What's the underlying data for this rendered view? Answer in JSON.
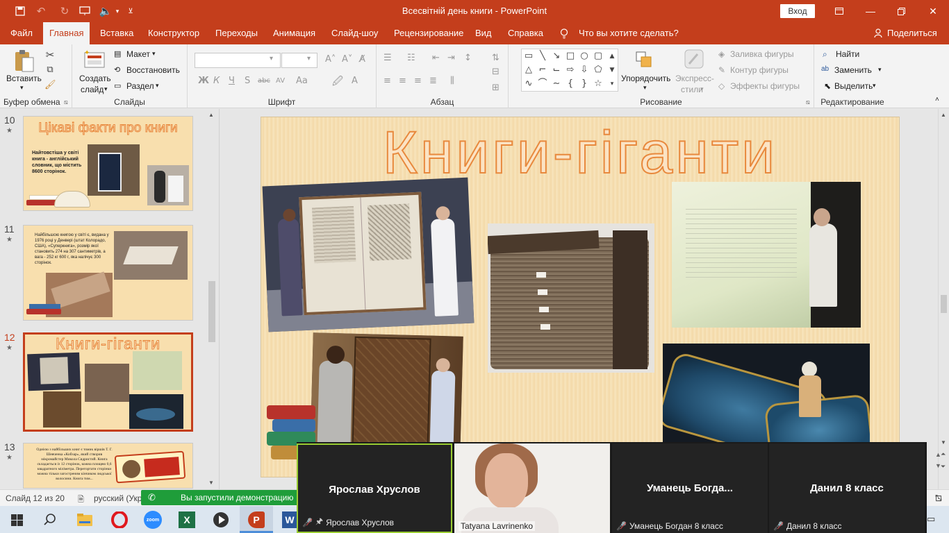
{
  "app": {
    "title": "Всесвітній день книги  -  PowerPoint",
    "signin": "Вход",
    "tell_me": "Что вы хотите сделать?",
    "share": "Поделиться"
  },
  "tabs": [
    "Файл",
    "Главная",
    "Вставка",
    "Конструктор",
    "Переходы",
    "Анимация",
    "Слайд-шоу",
    "Рецензирование",
    "Вид",
    "Справка"
  ],
  "ribbon": {
    "clipboard": {
      "paste": "Вставить",
      "label": "Буфер обмена"
    },
    "slides": {
      "new_slide_line1": "Создать",
      "new_slide_line2": "слайд",
      "layout": "Макет",
      "reset": "Восстановить",
      "section": "Раздел",
      "label": "Слайды"
    },
    "font": {
      "bold": "Ж",
      "italic": "К",
      "underline": "Ч",
      "strike": "S",
      "label": "Шрифт"
    },
    "paragraph": {
      "label": "Абзац"
    },
    "drawing": {
      "arrange": "Упорядочить",
      "quick_styles_line1": "Экспресс-",
      "quick_styles_line2": "стили",
      "fill": "Заливка фигуры",
      "outline": "Контур фигуры",
      "effects": "Эффекты фигуры",
      "label": "Рисование"
    },
    "editing": {
      "find": "Найти",
      "replace": "Заменить",
      "select": "Выделить",
      "label": "Редактирование"
    }
  },
  "thumbnails": [
    {
      "num": "10",
      "title": "Цікаві факти про книги",
      "body": "Найтовстіша у світі книга - англійський словник, що містить 8600 сторінок."
    },
    {
      "num": "11",
      "body": "Найбільшою книгою у світі є, видана у 1976 році у Денвері (штат Колорадо, США), «Суперкнига», розмір якої становить 274 на 307 сантиметрів, а вага - 252 кг 600 г, яка налічує 300 сторінок."
    },
    {
      "num": "12",
      "title": "Книги-гіганти"
    },
    {
      "num": "13",
      "body": "Однією з найбільших книг є томик віршів Т. Г. Шевченка «Кобзар», який створив мікромайстер Микола Сядристий. Книга складається із 12 сторінок, кожна площею 0,6 квадратного міліметра. Перегортати сторінки можна тільки загостреним кінчиком людської волосини. Книга тим..."
    }
  ],
  "slide": {
    "title": "Книги-гіганти"
  },
  "status": {
    "slide_info": "Слайд 12 из 20",
    "language": "русский (Укр"
  },
  "zoom": {
    "notice": "Вы запустили демонстрацию",
    "participants": [
      {
        "tile_name": "Ярослав Хруслов",
        "label": "Ярослав Хруслов"
      },
      {
        "label": "Tatyana Lavrinenko"
      },
      {
        "tile_name": "Уманець  Богда...",
        "label": "Уманець Богдан 8 класс"
      },
      {
        "tile_name": "Данил 8 класс",
        "label": "Данил 8 класс"
      }
    ]
  },
  "taskbar": {
    "icons": [
      "windows-start",
      "search",
      "file-explorer",
      "opera",
      "zoom",
      "excel",
      "media-player",
      "powerpoint",
      "word"
    ],
    "icon_labels": {
      "zoom": "zoom"
    }
  },
  "colors": {
    "accent": "#c43e1c",
    "slide_title_outline": "#e8893d",
    "slide_bg": "#f7e2b8",
    "zoom_green": "#1f9d3a"
  }
}
